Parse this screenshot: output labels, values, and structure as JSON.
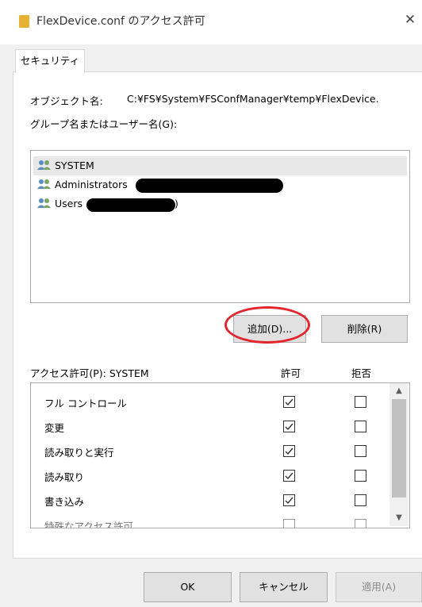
{
  "window": {
    "title": "FlexDevice.conf のアクセス許可",
    "close_glyph": "✕"
  },
  "tab": {
    "label": "セキュリティ"
  },
  "object": {
    "label": "オブジェクト名:",
    "value": "C:¥FS¥System¥FSConfManager¥temp¥FlexDevice."
  },
  "groups": {
    "label": "グループ名またはユーザー名(G):",
    "items": [
      {
        "name": "SYSTEM",
        "selected": true
      },
      {
        "name": "Administrators",
        "suffix": ""
      },
      {
        "name": "Users",
        "suffix": ")"
      }
    ]
  },
  "buttons": {
    "add": "追加(D)...",
    "remove": "削除(R)",
    "ok": "OK",
    "cancel": "キャンセル",
    "apply": "適用(A)"
  },
  "permissions": {
    "label": "アクセス許可(P): SYSTEM",
    "allow_header": "許可",
    "deny_header": "拒否",
    "items": [
      {
        "name": "フル コントロール",
        "allow": true,
        "deny": false
      },
      {
        "name": "変更",
        "allow": true,
        "deny": false
      },
      {
        "name": "読み取りと実行",
        "allow": true,
        "deny": false
      },
      {
        "name": "読み取り",
        "allow": true,
        "deny": false
      },
      {
        "name": "書き込み",
        "allow": true,
        "deny": false
      },
      {
        "name": "特殊なアクセス許可",
        "allow": false,
        "deny": false,
        "disabled": true
      }
    ]
  },
  "colors": {
    "highlight_ring": "#e3252d"
  },
  "icons": {
    "title": "folder-icon",
    "user": "users-icon",
    "scroll_up": "chevron-up-icon",
    "scroll_down": "chevron-down-icon"
  }
}
